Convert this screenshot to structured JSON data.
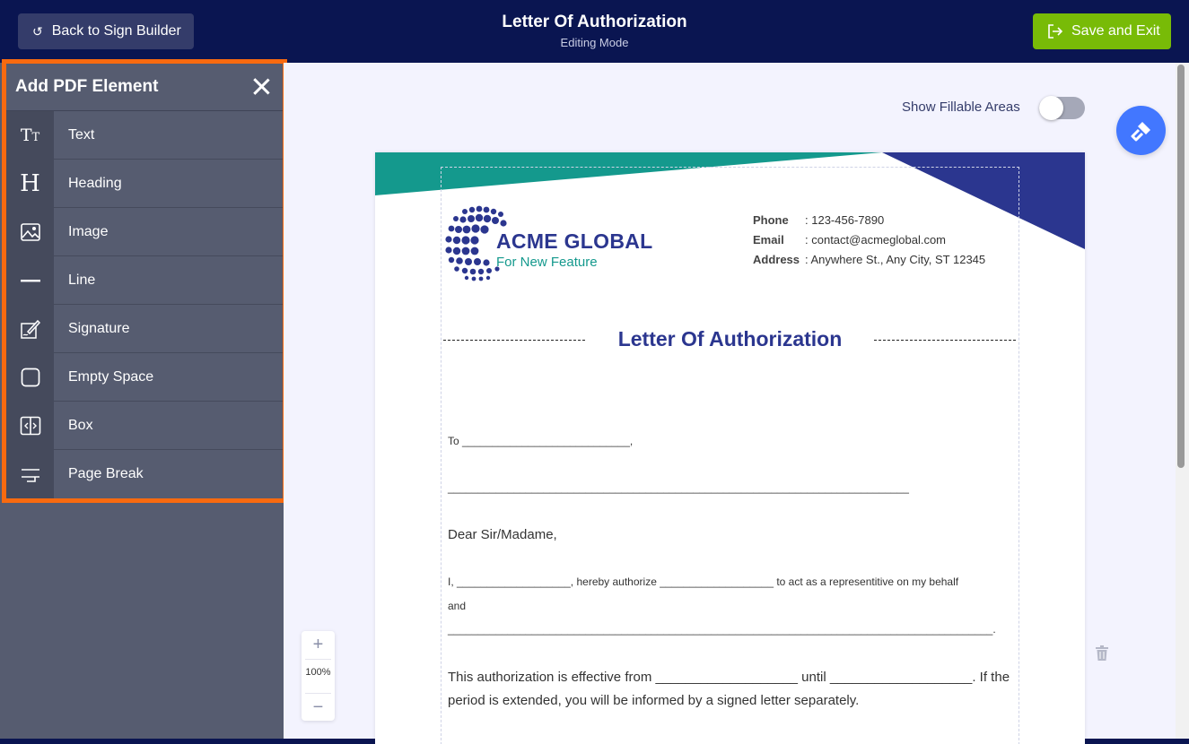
{
  "header": {
    "back_label": "Back to Sign Builder",
    "title": "Letter Of Authorization",
    "subtitle": "Editing Mode",
    "save_label": "Save and Exit",
    "colors": {
      "bar": "#0a1551",
      "save": "#78bb07",
      "back": "#343c6a"
    }
  },
  "panel": {
    "title": "Add PDF Element",
    "highlight_color": "#f86a10",
    "items": [
      {
        "label": "Text",
        "icon": "text-icon"
      },
      {
        "label": "Heading",
        "icon": "heading-icon"
      },
      {
        "label": "Image",
        "icon": "image-icon"
      },
      {
        "label": "Line",
        "icon": "line-icon"
      },
      {
        "label": "Signature",
        "icon": "signature-icon"
      },
      {
        "label": "Empty Space",
        "icon": "empty-space-icon"
      },
      {
        "label": "Box",
        "icon": "box-icon"
      },
      {
        "label": "Page Break",
        "icon": "page-break-icon"
      }
    ]
  },
  "toolbar": {
    "fillable_label": "Show Fillable Areas",
    "fillable_on": false,
    "zoom_value": "100%",
    "zoom_in": "+",
    "zoom_out": "−"
  },
  "document": {
    "company": "ACME GLOBAL",
    "tagline": "For New Feature",
    "phone_label": "Phone",
    "phone": "123-456-7890",
    "email_label": "Email",
    "email": "contact@acmeglobal.com",
    "address_label": "Address",
    "address": "Anywhere St., Any City, ST 12345",
    "title": "Letter Of Authorization",
    "to_line": "To ____________________________,",
    "blank_line": "_____________________________________________________________________________",
    "salutation": "Dear Sir/Madame,",
    "body1": "I, ___________________, hereby authorize ___________________ to act as a representitive on my behalf",
    "body2": "and",
    "body3": "___________________________________________________________________________________________.",
    "body4": "This authorization is effective from ___________________ until ___________________. If the",
    "body5": "period is extended, you will be informed by a signed letter separately.",
    "colors": {
      "teal": "#14998d",
      "navy": "#2b368f"
    }
  }
}
